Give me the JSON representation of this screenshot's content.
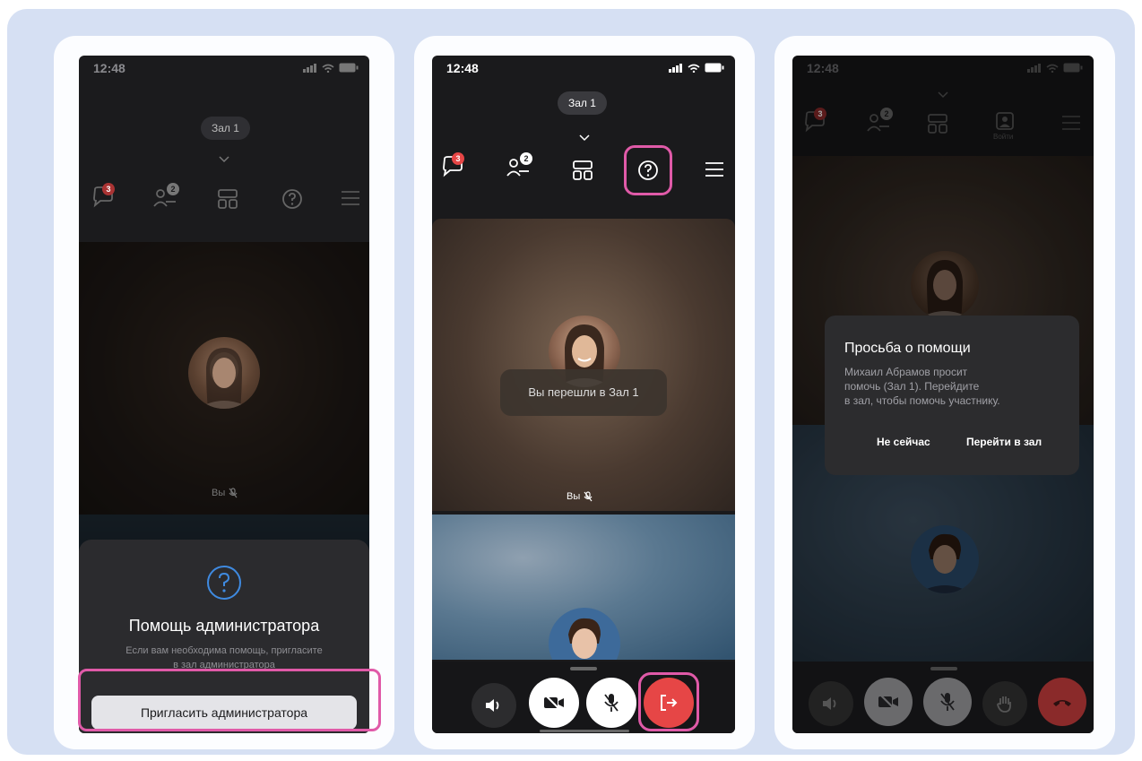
{
  "screens": [
    {
      "time": "12:48",
      "room": "Зал 1",
      "toolbar": {
        "chat_badge": "3",
        "participants_badge": "2"
      },
      "tile_you_label": "Вы",
      "sheet": {
        "title": "Помощь администратора",
        "description_line1": "Если вам необходима помощь, пригласите",
        "description_line2": "в зал администратора",
        "button": "Пригласить администратора"
      }
    },
    {
      "time": "12:48",
      "room": "Зал 1",
      "toolbar": {
        "chat_badge": "3",
        "participants_badge": "2"
      },
      "toast": "Вы перешли в Зал 1",
      "tile_you_label": "Вы"
    },
    {
      "time": "12:48",
      "toolbar": {
        "chat_badge": "3",
        "participants_badge": "2",
        "join_label": "Войти"
      },
      "dialog": {
        "title": "Просьба о помощи",
        "body_line1": "Михаил Абрамов просит",
        "body_line2": "помочь (Зал 1). Перейдите",
        "body_line3": "в зал, чтобы помочь участнику.",
        "cancel": "Не сейчас",
        "confirm": "Перейти в зал"
      }
    }
  ],
  "colors": {
    "accent_pink": "#e05aa8",
    "end_call_red": "#e64646",
    "help_blue": "#3f8ae0"
  }
}
